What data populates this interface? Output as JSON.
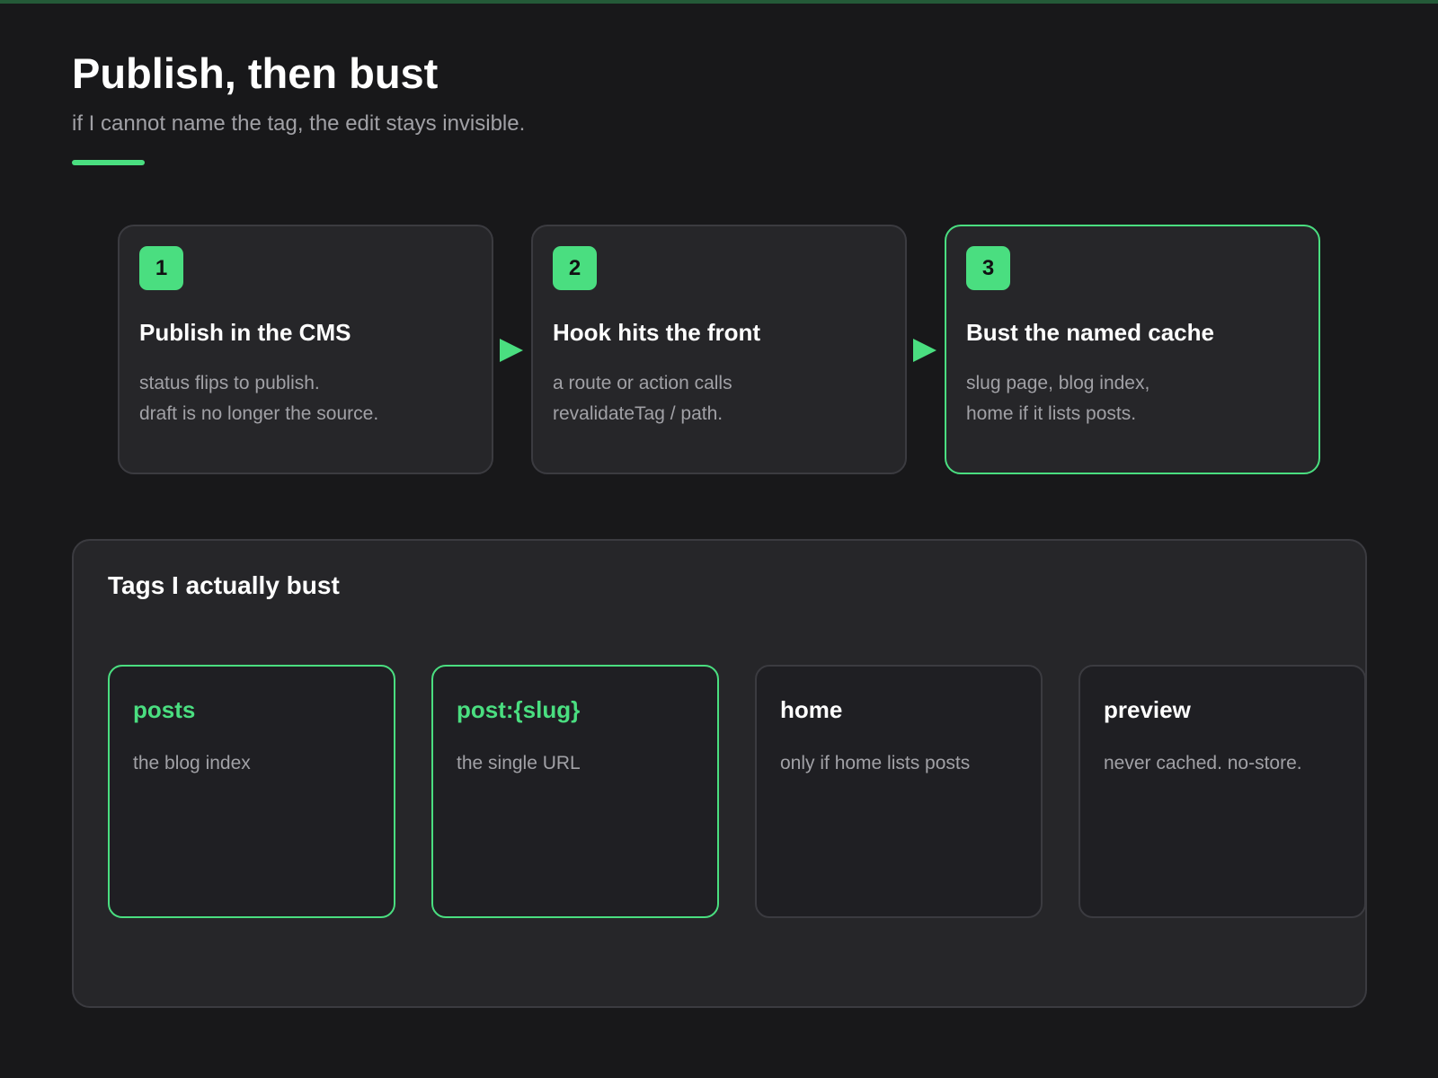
{
  "header": {
    "title": "Publish, then bust",
    "subtitle": "if I cannot name the tag, the edit stays invisible."
  },
  "colors": {
    "background": "#18181a",
    "card": "#262629",
    "accent": "#4ade80",
    "muted_text": "#a1a1a6"
  },
  "steps": [
    {
      "number": "1",
      "title": "Publish in the CMS",
      "lines": [
        "status flips to publish.",
        "draft is no longer the source."
      ],
      "highlighted": false
    },
    {
      "number": "2",
      "title": "Hook hits the front",
      "lines": [
        "a route or action calls",
        "revalidateTag / path."
      ],
      "highlighted": false
    },
    {
      "number": "3",
      "title": "Bust the named cache",
      "lines": [
        "slug page, blog index,",
        "home if it lists posts."
      ],
      "highlighted": true
    }
  ],
  "tags_panel": {
    "title": "Tags I actually bust",
    "tags": [
      {
        "name": "posts",
        "description": "the blog index",
        "highlighted": true
      },
      {
        "name": "post:{slug}",
        "description": "the single URL",
        "highlighted": true
      },
      {
        "name": "home",
        "description": "only if home lists posts",
        "highlighted": false
      },
      {
        "name": "preview",
        "description": "never cached. no-store.",
        "highlighted": false
      }
    ]
  }
}
